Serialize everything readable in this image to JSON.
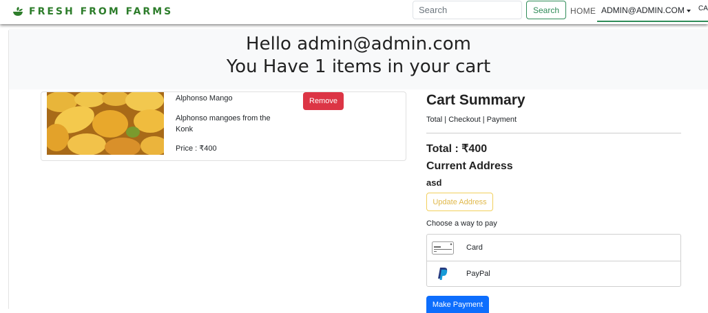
{
  "navbar": {
    "brand": "FRESH FROM FARMS",
    "brand_icon": "bowl-leaf-icon",
    "search_placeholder": "Search",
    "search_button": "Search",
    "home": "HOME",
    "user": "ADMIN@ADMIN.COM",
    "cart": "CA",
    "accent_color": "#2e8b57"
  },
  "hero": {
    "line1": "Hello admin@admin.com",
    "line2": "You Have 1 items in your cart"
  },
  "cart_items": [
    {
      "name": "Alphonso Mango",
      "description": "Alphonso mangoes from the Konk",
      "price": "Price : ₹400",
      "remove_label": "Remove",
      "image_icon": "mango-photo"
    }
  ],
  "summary": {
    "title": "Cart Summary",
    "links": "Total | Checkout | Payment",
    "total": "Total : ₹400",
    "address_title": "Current Address",
    "address_value": "asd",
    "update_address": "Update Address",
    "choose_pay": "Choose a way to pay",
    "payment_options": [
      {
        "label": "Card",
        "icon": "credit-card-icon"
      },
      {
        "label": "PayPal",
        "icon": "paypal-icon"
      }
    ],
    "make_payment": "Make Payment"
  },
  "colors": {
    "danger": "#dc3545",
    "primary": "#0d6efd",
    "warning": "#f2cf5b"
  }
}
